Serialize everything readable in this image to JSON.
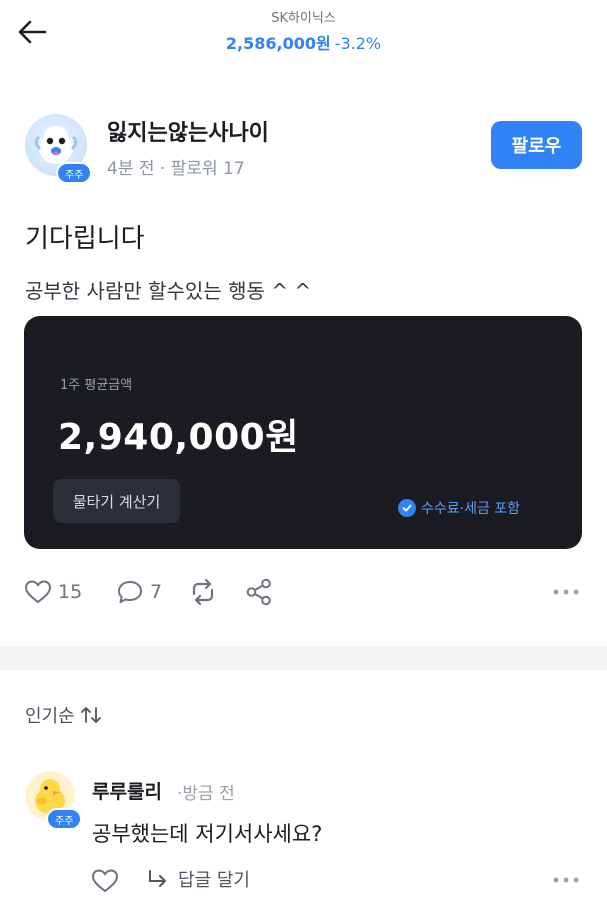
{
  "header": {
    "stock_name": "SK하이닉스",
    "price": "2,586,000원",
    "change": "-3.2%"
  },
  "post": {
    "author": {
      "name": "잃지는않는사나이",
      "badge": "주주",
      "time": "4분 전",
      "separator": "·",
      "followers": "팔로워 17"
    },
    "follow_label": "팔로우",
    "title": "기다립니다",
    "body": "공부한 사람만 할수있는 행동  ^ ^",
    "card": {
      "label": "1주 평균금액",
      "amount": "2,940,000원",
      "button_label": "물타기 계산기",
      "fee_note": "수수료·세금 포함"
    },
    "stats": {
      "likes": "15",
      "comments": "7"
    }
  },
  "comments": {
    "sort_label": "인기순",
    "items": [
      {
        "name": "루루룰리",
        "time": "·방금 전",
        "badge": "주주",
        "text": "공부했는데 저기서사세요?",
        "reply_label": "답글 달기"
      }
    ]
  },
  "colors": {
    "accent": "#3182f6",
    "card_bg": "#1b1c22",
    "muted": "#8b95a1"
  },
  "icons": [
    "back-arrow-icon",
    "heart-icon",
    "comment-icon",
    "repost-icon",
    "share-icon",
    "more-icon",
    "check-icon",
    "sort-icon",
    "reply-arrow-icon"
  ]
}
